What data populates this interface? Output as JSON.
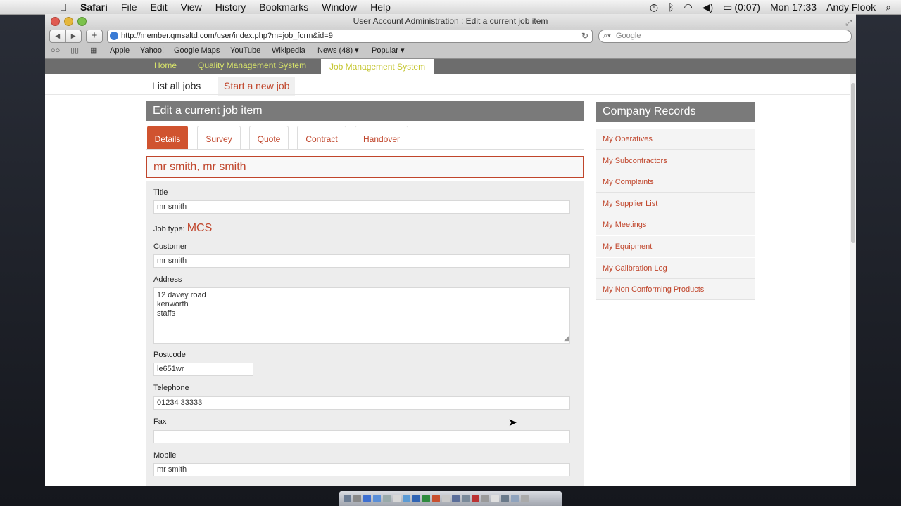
{
  "menubar": {
    "apple_icon": "",
    "app": "Safari",
    "items": [
      "File",
      "Edit",
      "View",
      "History",
      "Bookmarks",
      "Window",
      "Help"
    ],
    "battery": "(0:07)",
    "clock": "Mon 17:33",
    "user": "Andy Flook"
  },
  "window": {
    "title": "User Account Administration : Edit a current job item"
  },
  "toolbar": {
    "url": "http://member.qmsaltd.com/user/index.php?m=job_form&id=9",
    "search_placeholder": "Google"
  },
  "bookmarks": [
    "Apple",
    "Yahoo!",
    "Google Maps",
    "YouTube",
    "Wikipedia",
    "News (48) ▾",
    "Popular ▾"
  ],
  "sitenav": {
    "home": "Home",
    "qms": "Quality Management System",
    "jms": "Job Management System"
  },
  "subnav": {
    "list_jobs": "List all jobs",
    "new_job": "Start a new job"
  },
  "main": {
    "heading": "Edit a current job item",
    "tabs": [
      "Details",
      "Survey",
      "Quote",
      "Contract",
      "Handover"
    ],
    "active_tab": "Details",
    "customer_banner": "mr smith, mr smith"
  },
  "form": {
    "title_label": "Title",
    "title_value": "mr smith",
    "job_type_label": "Job type:",
    "job_type_value": "MCS",
    "customer_label": "Customer",
    "customer_value": "mr smith",
    "address_label": "Address",
    "address_lines": [
      "12 davey road",
      "kenworth",
      "staffs"
    ],
    "postcode_label": "Postcode",
    "postcode_value": "le651wr",
    "telephone_label": "Telephone",
    "telephone_value": "01234 33333",
    "fax_label": "Fax",
    "fax_value": "",
    "mobile_label": "Mobile",
    "mobile_value": "mr smith"
  },
  "sidebar": {
    "heading": "Company Records",
    "items": [
      "My Operatives",
      "My Subcontractors",
      "My Complaints",
      "My Supplier List",
      "My Meetings",
      "My Equipment",
      "My Calibration Log",
      "My Non Conforming Products"
    ]
  },
  "colors": {
    "accent": "#c0452b",
    "active_tab": "#d0532f",
    "nav_bar": "#6d6d6d",
    "nav_link": "#d7e36a",
    "panel_head": "#7a7a7a"
  }
}
